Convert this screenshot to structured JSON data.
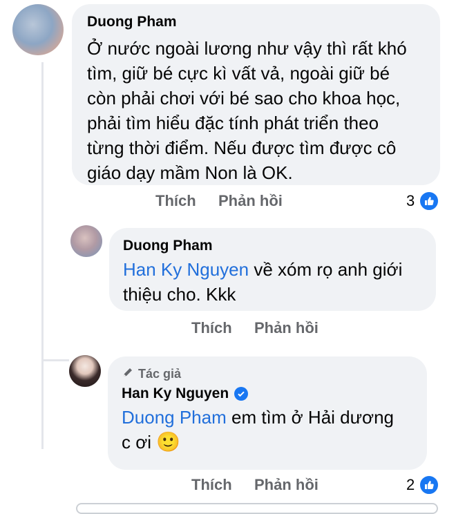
{
  "comments": [
    {
      "author": "Duong Pham",
      "text": "Ở nước ngoài lương như vậy thì rất khó tìm, giữ bé cực kì vất vả, ngoài giữ bé còn phải chơi với bé sao cho khoa học, phải tìm hiểu đặc tính phát triển theo từng thời điểm. Nếu được tìm được cô giáo dạy mầm Non là OK.",
      "text_lines": [
        "Ở nước ngoài lương như vậy thì rất khó",
        "tìm, giữ bé cực kì vất vả, ngoài giữ bé",
        "còn phải chơi với bé sao cho khoa học,",
        "phải tìm hiểu đặc tính phát triển theo",
        "từng thời điểm. Nếu được tìm được cô",
        "giáo dạy mầm Non là OK."
      ],
      "like_label": "Thích",
      "reply_label": "Phản hồi",
      "reaction_count": "3"
    },
    {
      "author": "Duong Pham",
      "mention": "Han Ky Nguyen",
      "text_rest_line1": " về xóm rọ anh giới",
      "text_line2": "thiệu cho. Kkk",
      "like_label": "Thích",
      "reply_label": "Phản hồi"
    },
    {
      "badge": "Tác giả",
      "author": "Han Ky Nguyen",
      "mention": "Duong Pham",
      "text_rest_line1": " em tìm ở Hải dương",
      "text_line2": "c ơi ",
      "emoji": "🙂",
      "like_label": "Thích",
      "reply_label": "Phản hồi",
      "reaction_count": "2"
    }
  ],
  "colors": {
    "bubble": "#f0f2f5",
    "mention": "#216fdb",
    "action": "#65676b",
    "like_blue": "#1877f2"
  },
  "icons": [
    "like-icon",
    "verified-icon",
    "pen-icon"
  ]
}
